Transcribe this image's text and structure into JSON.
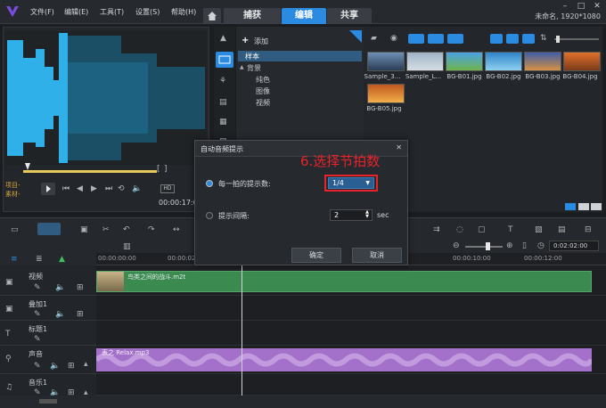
{
  "menu": [
    "文件(F)",
    "编辑(E)",
    "工具(T)",
    "设置(S)",
    "帮助(H)"
  ],
  "tabs": [
    "捕获",
    "编辑",
    "共享"
  ],
  "project_info": "未命名, 1920*1080",
  "preview": {
    "project_label": "项目-",
    "clip_label": "素材-",
    "timecode": "00:00:17:00"
  },
  "library": {
    "add_label": "添加",
    "tree": [
      "样本",
      "背景",
      "纯色",
      "图像",
      "视频"
    ],
    "thumbnails": [
      "Sample_3...",
      "Sample_L...",
      "BG-B01.jpg",
      "BG-B02.jpg",
      "BG-B03.jpg",
      "BG-B04.jpg",
      "BG-B05.jpg"
    ]
  },
  "timeline": {
    "timecode": "0:02:02:00",
    "ruler_ticks": [
      "00:00:00:00",
      "00:00:02:00",
      "00:00:10:00",
      "00:00:12:00"
    ],
    "tracks": [
      "视频",
      "叠加1",
      "标题1",
      "声音",
      "音乐1"
    ],
    "video_clip": "鸟类之间的战斗.m2t",
    "audio_clip": "表之 Relax.mp3"
  },
  "dialog": {
    "title": "自动音频提示",
    "annotation": "6.选择节拍数",
    "beat_label": "每一拍的提示数:",
    "beat_value": "1/4",
    "interval_label": "提示间隔:",
    "interval_value": "2",
    "interval_unit": "sec",
    "ok": "确定",
    "cancel": "取消"
  },
  "colors": {
    "accent": "#2a8be0",
    "waveform": "#2fb0e8",
    "audio_clip": "#a371c9",
    "video_clip": "#3b8a4f",
    "annotation": "#e8232a"
  }
}
